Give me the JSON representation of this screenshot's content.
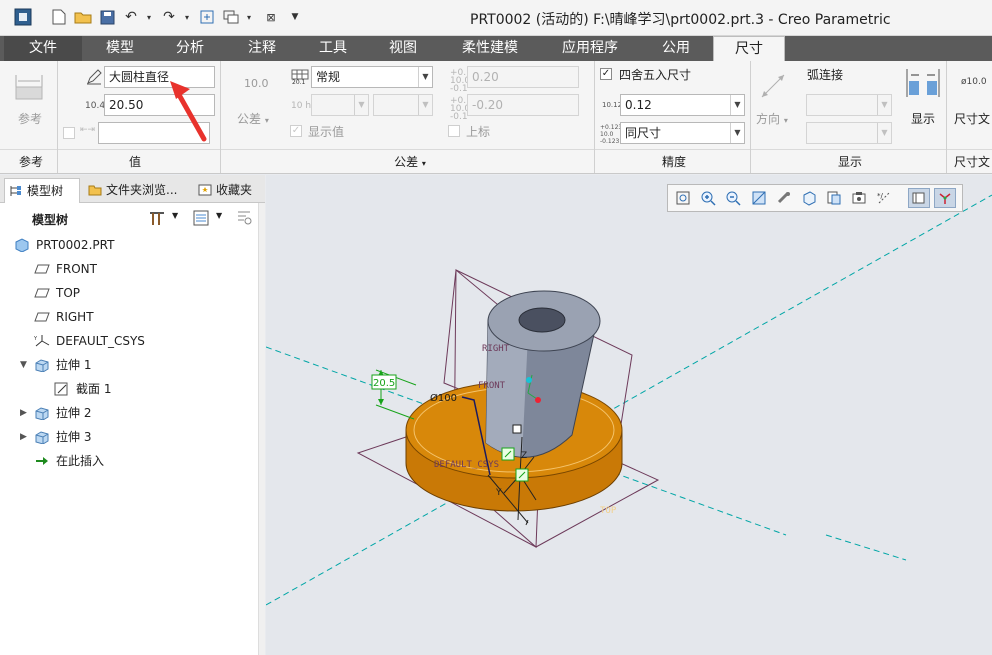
{
  "titlebar": {
    "title": "PRT0002 (活动的) F:\\晴峰学习\\prt0002.prt.3 - Creo Parametric"
  },
  "tabs": [
    "文件",
    "模型",
    "分析",
    "注释",
    "工具",
    "视图",
    "柔性建模",
    "应用程序",
    "公用",
    "尺寸"
  ],
  "ribbon": {
    "reference": {
      "label": "参考",
      "group": "参考"
    },
    "value": {
      "group": "值",
      "name_value": "大圆柱直径",
      "dim_value": "20.50",
      "dim_prefix": "10.4",
      "bottom_field": ""
    },
    "tolerance": {
      "group": "公差",
      "tol_label": "公差",
      "tol_preview": "10.0",
      "mode_value": "常规",
      "upper_value": "0.20",
      "lower_value": "-0.20",
      "show_value_label": "显示值",
      "upper_label": "上标",
      "fit_prefix": "10 h7"
    },
    "precision": {
      "group": "精度",
      "round_label": "四舍五入尺寸",
      "decimals_value": "0.12",
      "tol_decimals_value": "同尺寸"
    },
    "display": {
      "group": "显示",
      "direction_label": "方向",
      "arc_label": "弧连接",
      "display_label": "显示"
    },
    "dimtext": {
      "group": "尺寸文",
      "label": "尺寸文",
      "preview": "ø10.0"
    }
  },
  "panel": {
    "tabs": [
      "模型树",
      "文件夹浏览...",
      "收藏夹"
    ],
    "header": "模型树",
    "items": [
      {
        "label": "PRT0002.PRT",
        "icon": "part-icon",
        "indent": 0
      },
      {
        "label": "FRONT",
        "icon": "datum-plane-icon",
        "indent": 1
      },
      {
        "label": "TOP",
        "icon": "datum-plane-icon",
        "indent": 1
      },
      {
        "label": "RIGHT",
        "icon": "datum-plane-icon",
        "indent": 1
      },
      {
        "label": "DEFAULT_CSYS",
        "icon": "csys-icon",
        "indent": 1
      },
      {
        "label": "拉伸 1",
        "icon": "extrude-icon",
        "indent": 1,
        "expander": "▼"
      },
      {
        "label": "截面 1",
        "icon": "sketch-icon",
        "indent": 2
      },
      {
        "label": "拉伸 2",
        "icon": "extrude-icon",
        "indent": 1,
        "expander": "▶"
      },
      {
        "label": "拉伸 3",
        "icon": "extrude-icon",
        "indent": 1,
        "expander": "▶"
      },
      {
        "label": "在此插入",
        "icon": "insert-here-icon",
        "indent": 1
      }
    ]
  },
  "viewport": {
    "labels": {
      "right": "RIGHT",
      "front": "FRONT",
      "top": "TOP",
      "csys": "DEFAULT_CSYS",
      "dim_height": "20.5",
      "dim_diameter": "Ø100",
      "axis_z": "Z",
      "axis_y": "Y"
    },
    "colors": {
      "disc": "#d8880a",
      "cylinder": "#8a93a6",
      "datum_line": "#00a6a6",
      "plane_line": "#6d3a5a",
      "dimension": "#17a31a"
    }
  }
}
